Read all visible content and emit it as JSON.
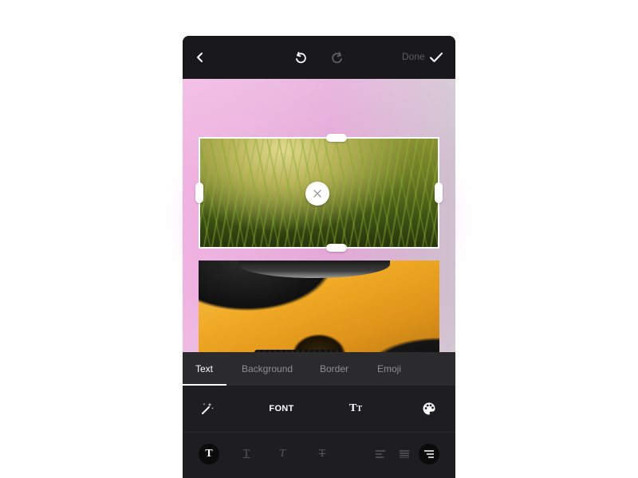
{
  "topbar": {
    "back_icon": "chevron-left-icon",
    "undo_icon": "undo-icon",
    "redo_icon": "redo-icon",
    "done_label": "Done",
    "done_icon": "check-icon"
  },
  "canvas": {
    "photos": [
      {
        "name": "grass-photo",
        "selected": true
      },
      {
        "name": "car-photo",
        "selected": false
      }
    ],
    "remove_icon": "close-icon"
  },
  "fab": {
    "label": "+",
    "icon": "plus-icon",
    "color": "#f13536"
  },
  "tabs": [
    {
      "label": "Text",
      "active": true
    },
    {
      "label": "Background",
      "active": false
    },
    {
      "label": "Border",
      "active": false
    },
    {
      "label": "Emoji",
      "active": false
    }
  ],
  "tools": {
    "magic_icon": "magic-wand-icon",
    "font_label": "FONT",
    "size_label_big": "T",
    "size_label_small": "T",
    "palette_icon": "palette-icon"
  },
  "styles": {
    "bold_label": "T",
    "underline_label": "T",
    "italic_label": "T",
    "strike_label": "T",
    "align_options": [
      "left",
      "center",
      "right"
    ],
    "selected_align": "right"
  },
  "colors": {
    "accent": "#f13536",
    "panel": "#1e1e20",
    "tabbar": "#2b2b2e"
  }
}
